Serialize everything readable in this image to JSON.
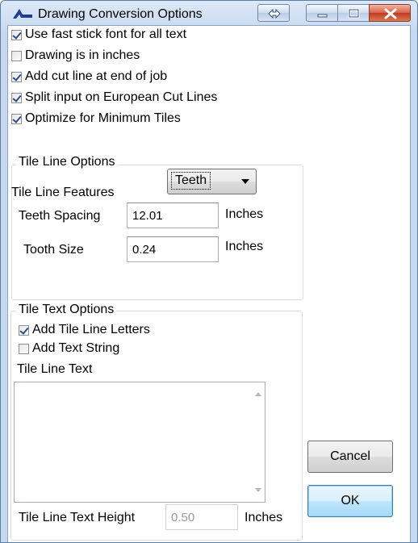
{
  "window": {
    "title": "Drawing Conversion Options",
    "accent_color": "#1c3f8f",
    "icons": {
      "app": "autocad-style-icon",
      "swap": "swap-arrows-icon",
      "minimize": "minimize-icon",
      "maximize": "maximize-icon",
      "close": "close-icon"
    }
  },
  "options": [
    {
      "label": "Use fast stick font for all text",
      "checked": true
    },
    {
      "label": "Drawing is in inches",
      "checked": false
    },
    {
      "label": "Add cut line at end of job",
      "checked": true
    },
    {
      "label": "Split input on European Cut Lines",
      "checked": true
    },
    {
      "label": "Optimize for Minimum Tiles",
      "checked": true
    }
  ],
  "tile_line_options": {
    "group_label": "Tile Line Options",
    "features_label": "Tile Line Features",
    "features_value": "Teeth",
    "teeth_spacing_label": "Teeth Spacing",
    "teeth_spacing_value": "12.01",
    "teeth_spacing_unit": "Inches",
    "tooth_size_label": "Tooth Size",
    "tooth_size_value": "0.24",
    "tooth_size_unit": "Inches"
  },
  "tile_text_options": {
    "group_label": "Tile Text Options",
    "add_letters": {
      "label": "Add Tile Line Letters",
      "checked": true
    },
    "add_string": {
      "label": "Add Text String",
      "checked": false
    },
    "text_label": "Tile Line Text",
    "text_value": "",
    "height_label": "Tile Line Text Height",
    "height_value": "0.50",
    "height_unit": "Inches"
  },
  "buttons": {
    "cancel": "Cancel",
    "ok": "OK"
  }
}
